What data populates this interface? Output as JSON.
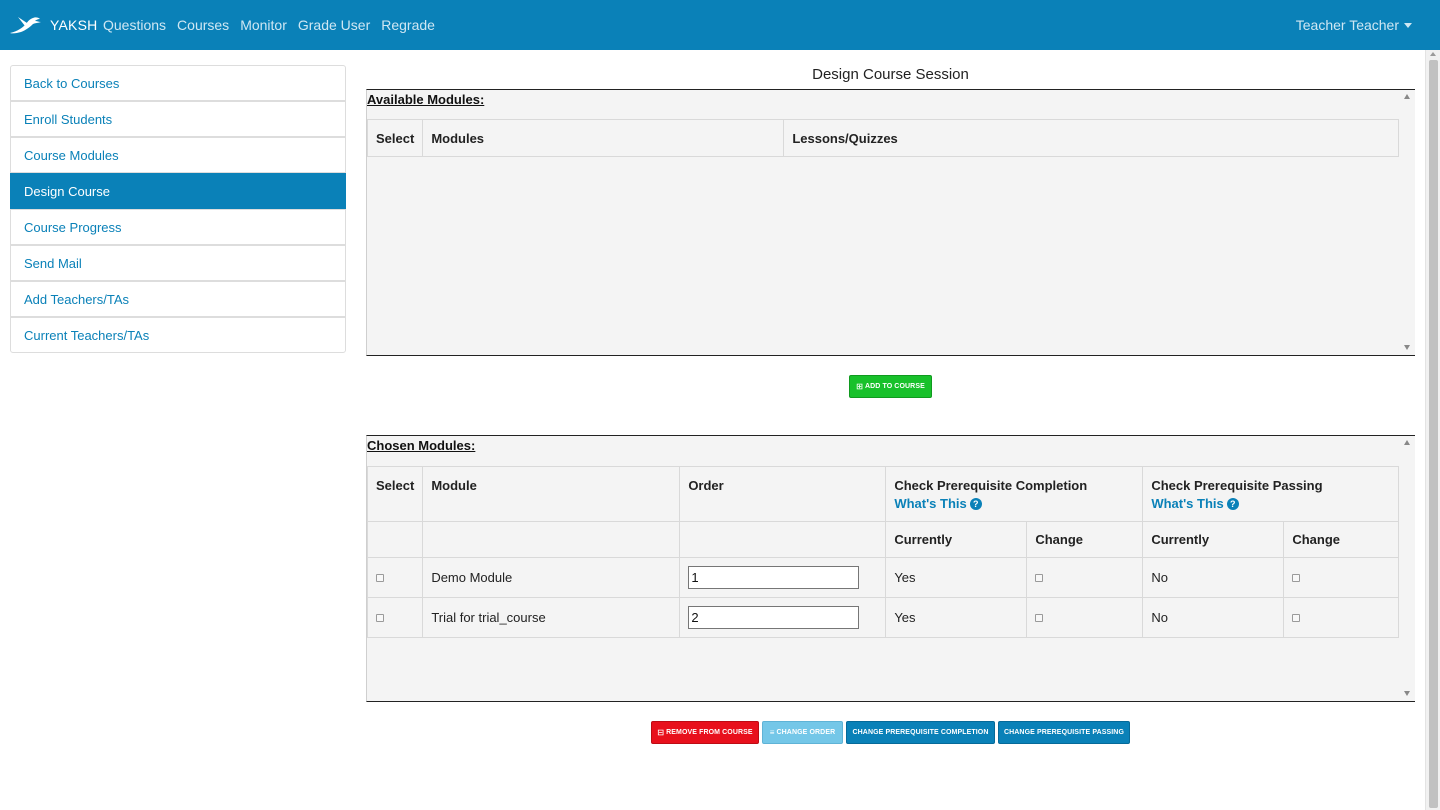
{
  "navbar": {
    "brand": "YAKSH",
    "links": [
      "Questions",
      "Courses",
      "Monitor",
      "Grade User",
      "Regrade"
    ],
    "user": "Teacher Teacher"
  },
  "sidebar": {
    "items": [
      {
        "label": "Back to Courses"
      },
      {
        "label": "Enroll Students"
      },
      {
        "label": "Course Modules"
      },
      {
        "label": "Design Course",
        "active": true
      },
      {
        "label": "Course Progress"
      },
      {
        "label": "Send Mail"
      },
      {
        "label": "Add Teachers/TAs"
      },
      {
        "label": "Current Teachers/TAs"
      }
    ]
  },
  "main": {
    "title": "Design Course Session",
    "available": {
      "title": "Available Modules:",
      "headers": [
        "Select",
        "Modules",
        "Lessons/Quizzes"
      ]
    },
    "add_button": "Add to course",
    "chosen": {
      "title": "Chosen Modules:",
      "headers": {
        "select": "Select",
        "module": "Module",
        "order": "Order",
        "completion": "Check Prerequisite Completion",
        "passing": "Check Prerequisite Passing",
        "whats_this": "What's This",
        "currently": "Currently",
        "change": "Change"
      },
      "rows": [
        {
          "module": "Demo Module",
          "order": "1",
          "completion_current": "Yes",
          "passing_current": "No"
        },
        {
          "module": "Trial for trial_course",
          "order": "2",
          "completion_current": "Yes",
          "passing_current": "No"
        }
      ]
    },
    "buttons": {
      "remove": "Remove from course",
      "change_order": "Change order",
      "change_completion": "Change prerequisite completion",
      "change_passing": "Change prerequisite passing"
    }
  },
  "colors": {
    "brand": "#0a81b8",
    "green": "#18c12b",
    "red": "#e8101c",
    "light_blue": "#74c7e8"
  }
}
